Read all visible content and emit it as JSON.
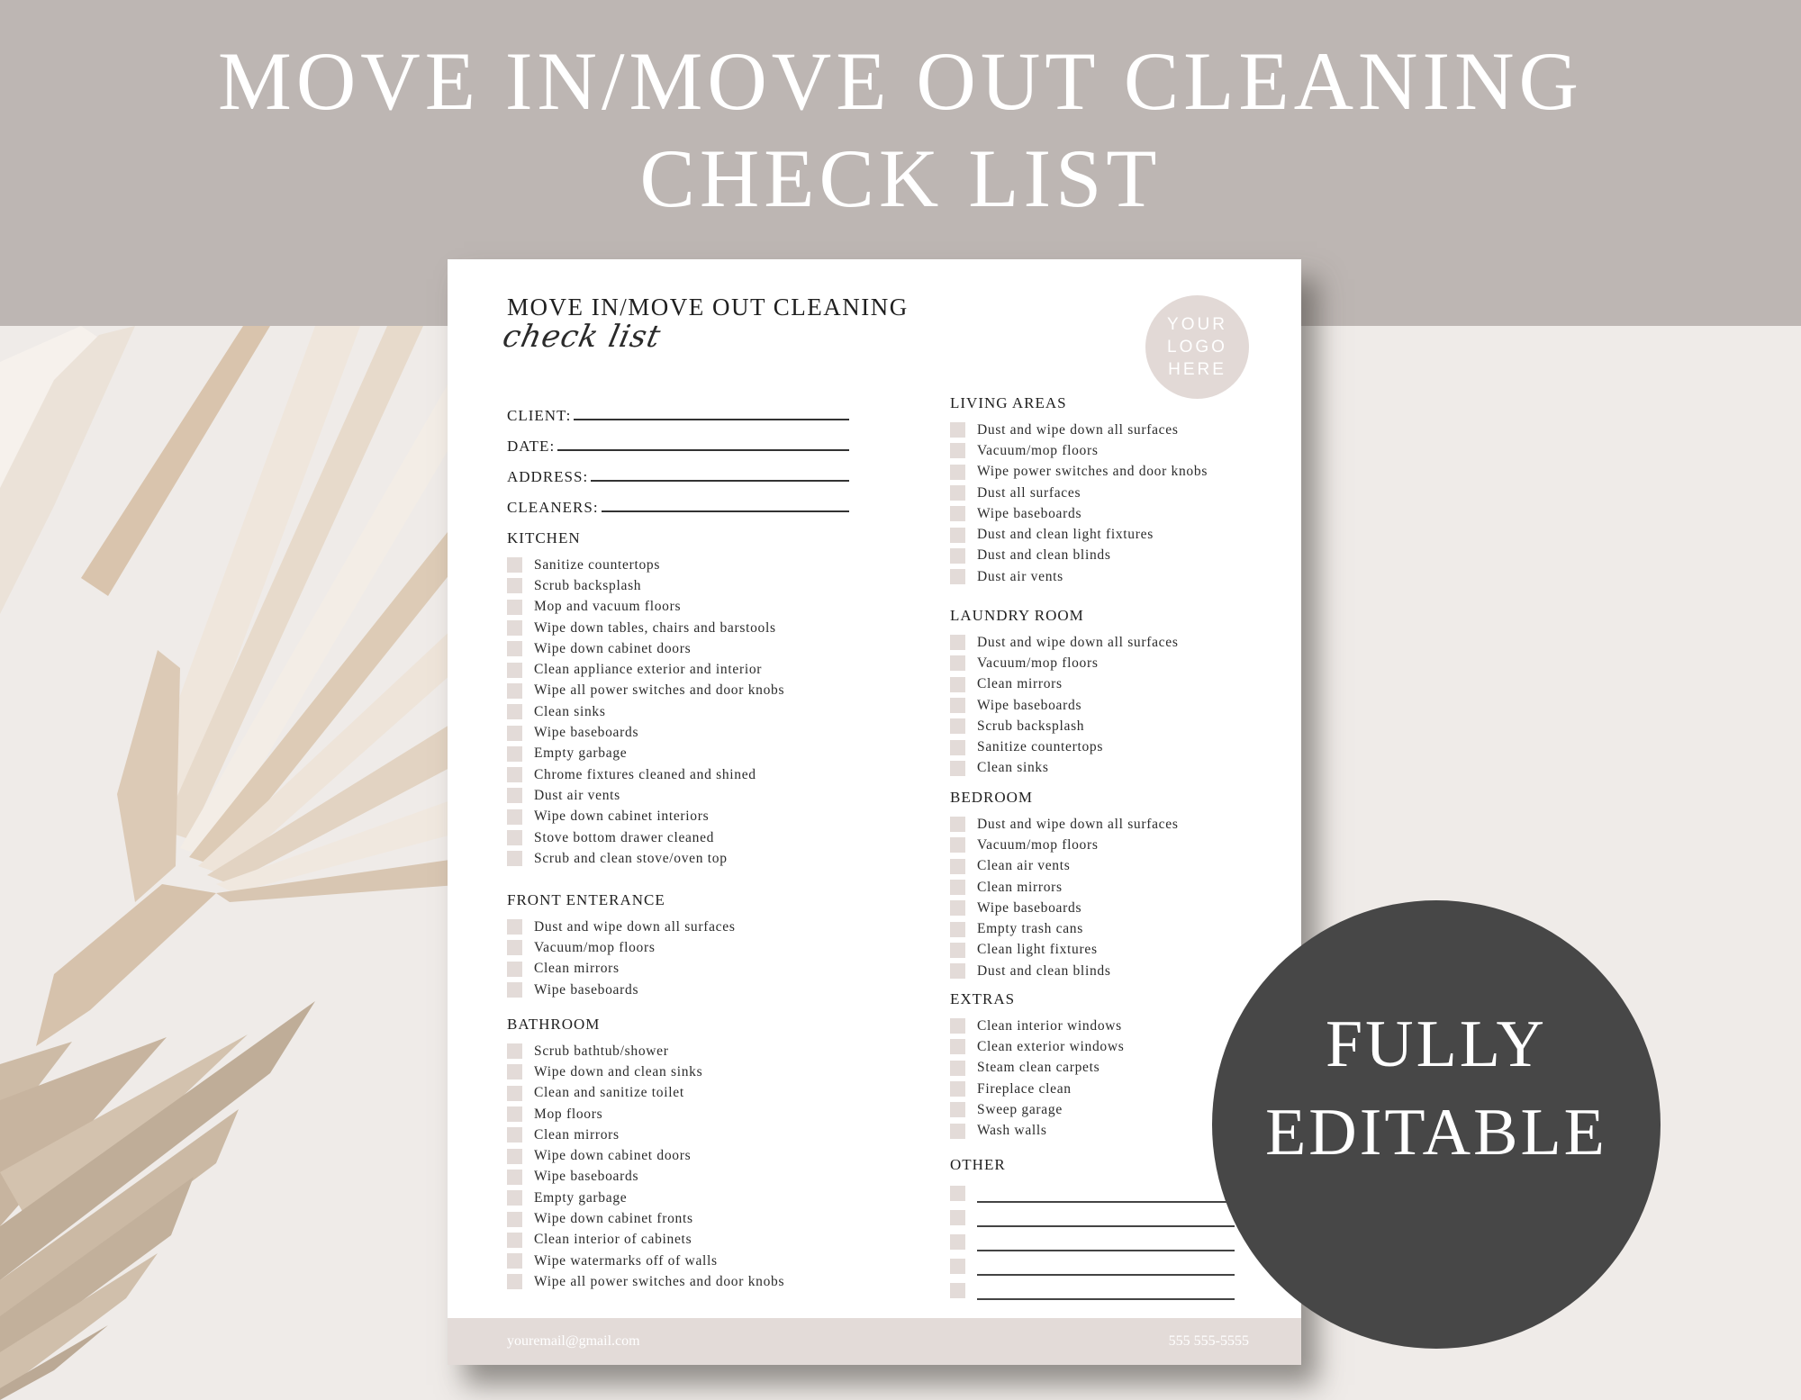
{
  "banner": {
    "line1": "MOVE IN/MOVE OUT CLEANING",
    "line2": "CHECK LIST"
  },
  "document": {
    "title": "MOVE IN/MOVE OUT CLEANING",
    "script_subtitle": "check list",
    "logo": {
      "line1": "YOUR",
      "line2": "LOGO",
      "line3": "HERE"
    },
    "fields": [
      {
        "label": "CLIENT:",
        "value": ""
      },
      {
        "label": "DATE:",
        "value": ""
      },
      {
        "label": "ADDRESS:",
        "value": ""
      },
      {
        "label": "CLEANERS:",
        "value": ""
      }
    ],
    "sections": {
      "kitchen": {
        "title": "KITCHEN",
        "items": [
          "Sanitize countertops",
          "Scrub backsplash",
          "Mop and vacuum floors",
          "Wipe down tables, chairs and barstools",
          "Wipe down cabinet doors",
          "Clean appliance exterior and interior",
          "Wipe all power switches and door knobs",
          "Clean sinks",
          "Wipe baseboards",
          "Empty garbage",
          "Chrome fixtures cleaned and shined",
          "Dust air vents",
          "Wipe down cabinet interiors",
          "Stove bottom drawer cleaned",
          "Scrub and clean stove/oven top"
        ]
      },
      "front_entrance": {
        "title": "FRONT ENTERANCE",
        "items": [
          "Dust and wipe down all surfaces",
          "Vacuum/mop floors",
          "Clean mirrors",
          "Wipe baseboards"
        ]
      },
      "bathroom": {
        "title": "BATHROOM",
        "items": [
          "Scrub bathtub/shower",
          "Wipe down and clean sinks",
          "Clean and sanitize toilet",
          "Mop floors",
          "Clean mirrors",
          "Wipe down cabinet doors",
          "Wipe baseboards",
          "Empty garbage",
          "Wipe down cabinet fronts",
          "Clean interior of cabinets",
          "Wipe watermarks off of walls",
          "Wipe all power switches and door knobs"
        ]
      },
      "living_areas": {
        "title": "LIVING AREAS",
        "items": [
          "Dust and wipe down all surfaces",
          "Vacuum/mop floors",
          "Wipe power switches and door knobs",
          "Dust all surfaces",
          "Wipe baseboards",
          "Dust and clean light fixtures",
          "Dust and clean blinds",
          "Dust air vents"
        ]
      },
      "laundry_room": {
        "title": "LAUNDRY ROOM",
        "items": [
          "Dust and wipe down all surfaces",
          "Vacuum/mop floors",
          "Clean mirrors",
          "Wipe baseboards",
          "Scrub backsplash",
          "Sanitize countertops",
          "Clean sinks"
        ]
      },
      "bedroom": {
        "title": "BEDROOM",
        "items": [
          "Dust and wipe down all surfaces",
          "Vacuum/mop floors",
          "Clean air vents",
          "Clean mirrors",
          "Wipe baseboards",
          "Empty trash cans",
          "Clean light fixtures",
          "Dust and clean blinds"
        ]
      },
      "extras": {
        "title": "EXTRAS",
        "items": [
          "Clean interior windows",
          "Clean exterior windows",
          "Steam clean carpets",
          "Fireplace clean",
          "Sweep garage",
          "Wash walls"
        ]
      },
      "other": {
        "title": "OTHER",
        "blank_lines": 5
      }
    },
    "footer": {
      "email": "youremail@gmail.com",
      "phone": "555 555-5555"
    }
  },
  "badge": {
    "line1": "FULLY",
    "line2": "EDITABLE",
    "color": "#474747"
  },
  "colors": {
    "header_band": "#bdb6b3",
    "background": "#efebe8",
    "checkbox": "#e3dbd8",
    "footer_band": "#e3dbd8"
  }
}
